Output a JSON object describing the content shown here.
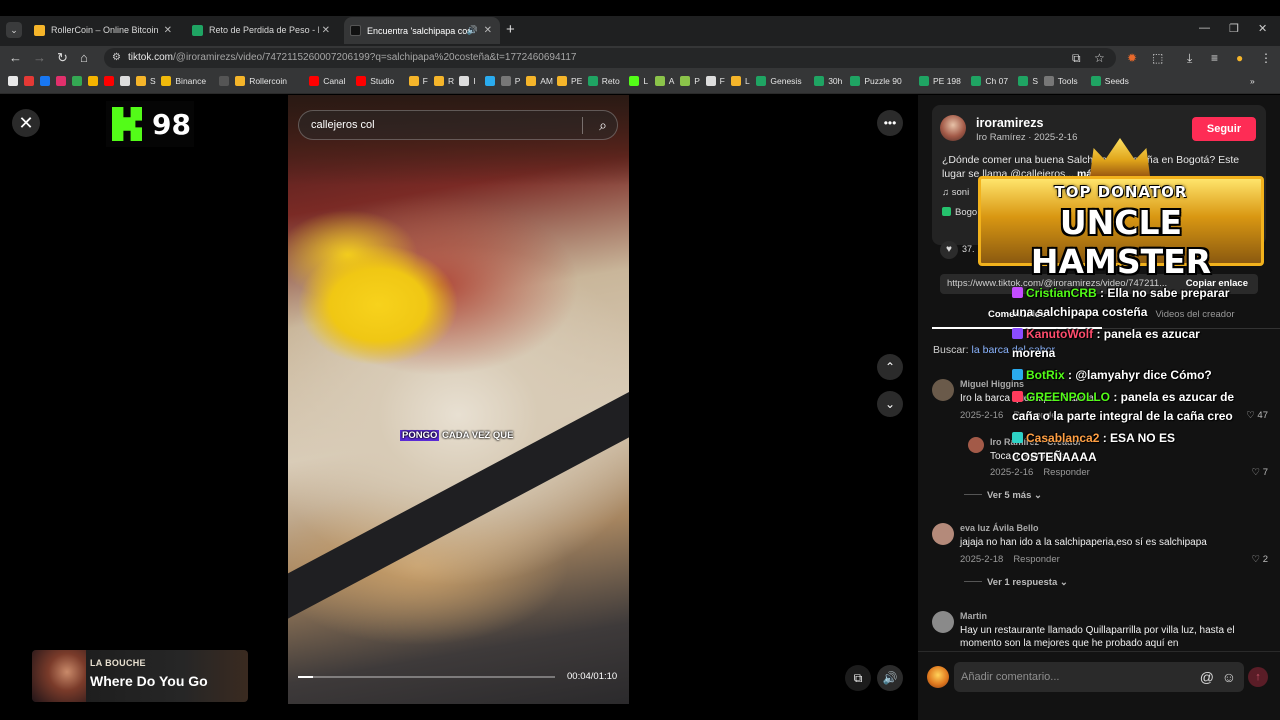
{
  "browser": {
    "tabs": [
      {
        "title": "RollerCoin – Online Bitcoin Mini",
        "favicon_color": "#f5b52a"
      },
      {
        "title": "Reto de Perdida de Peso - El M",
        "favicon_color": "#1fa463"
      },
      {
        "title": "Encuentra 'salchipapa coste",
        "favicon_color": "#111111"
      }
    ],
    "url_host": "tiktok.com",
    "url_rest": "/@iroramirezs/video/7472115260007206199?q=salchipapa%20costeña&t=1772460694117"
  },
  "bookmarks": [
    {
      "label": "",
      "color": "#e8e8e8"
    },
    {
      "label": "",
      "color": "#e53935"
    },
    {
      "label": "",
      "color": "#1877f2"
    },
    {
      "label": "",
      "color": "#e1306c"
    },
    {
      "label": "",
      "color": "#34a853"
    },
    {
      "label": "",
      "color": "#f4b400"
    },
    {
      "label": "",
      "color": "#ff0000"
    },
    {
      "label": "",
      "color": "#dddddd"
    },
    {
      "label": "S",
      "color": "#f5b52a"
    },
    {
      "label": "Binance",
      "color": "#f0b90b"
    },
    {
      "label": "",
      "color": "#555555"
    },
    {
      "label": "Rollercoin",
      "color": "#f5b52a"
    },
    {
      "label": "Canal",
      "color": "#ff0000"
    },
    {
      "label": "Studio",
      "color": "#ff0000"
    },
    {
      "label": "F",
      "color": "#f5b52a"
    },
    {
      "label": "R",
      "color": "#f5b52a"
    },
    {
      "label": "I",
      "color": "#dddddd"
    },
    {
      "label": "",
      "color": "#2aabee"
    },
    {
      "label": "P",
      "color": "#777777"
    },
    {
      "label": "AM",
      "color": "#f5b52a"
    },
    {
      "label": "PE",
      "color": "#f5b52a"
    },
    {
      "label": "Reto",
      "color": "#1fa463"
    },
    {
      "label": "L",
      "color": "#53fc18"
    },
    {
      "label": "A",
      "color": "#8bc34a"
    },
    {
      "label": "P",
      "color": "#8bc34a"
    },
    {
      "label": "F",
      "color": "#dddddd"
    },
    {
      "label": "L",
      "color": "#f5b52a"
    },
    {
      "label": "Genesis",
      "color": "#1fa463"
    },
    {
      "label": "30h",
      "color": "#1fa463"
    },
    {
      "label": "Puzzle 90",
      "color": "#1fa463"
    },
    {
      "label": "PE 198",
      "color": "#1fa463"
    },
    {
      "label": "Ch 07",
      "color": "#1fa463"
    },
    {
      "label": "S",
      "color": "#1fa463"
    },
    {
      "label": "Tools",
      "color": "#777777"
    },
    {
      "label": "Seeds",
      "color": "#1fa463"
    }
  ],
  "overlay": {
    "kick_count": "98",
    "now_playing_artist": "LA BOUCHE",
    "now_playing_song": "Where Do You Go",
    "donator_title": "TOP DONATOR",
    "donator_name": "UNCLE HAMSTER",
    "chat": [
      {
        "user": "CristianCRB",
        "color": "#53fc18",
        "message": ": Ella no sabe preparar una salchipapa costeña"
      },
      {
        "user": "KanutoWolf",
        "color": "#ff4d6d",
        "message": ": panela es azucar morena"
      },
      {
        "user": "BotRix",
        "color": "#53fc18",
        "message": ": @lamyahyr dice Cómo?"
      },
      {
        "user": "GREENPOLLO",
        "color": "#53fc18",
        "message": ": panela es azucar de caña o la parte integral de la caña creo"
      },
      {
        "user": "Casablanca2",
        "color": "#ff9f43",
        "message": ": ESA NO ES COSTEÑAAAA"
      }
    ]
  },
  "video": {
    "search_query": "callejeros col",
    "caption_highlight": "PONGO",
    "caption_rest": " CADA VEZ QUE",
    "time": "00:04/01:10",
    "progress": 0.057
  },
  "post": {
    "author": "iroramirezs",
    "meta": "Iro Ramírez · 2025-2-16",
    "follow_label": "Seguir",
    "description": "¿Dónde comer una buena Salchipapa costeña en Bogotá? Este lugar se llama @callejeros...",
    "more_label": "más",
    "music": "soni",
    "location": "Bogo",
    "likes": "37.",
    "link": "https://www.tiktok.com/@iroramirezs/video/747211...",
    "copy_label": "Copiar enlace"
  },
  "tabs": {
    "comments": "Comentarios",
    "creator": "Videos del creador"
  },
  "search_hint": {
    "label": "Buscar:",
    "query": "la barca del sabor"
  },
  "comments": [
    {
      "name": "Miguel Higgins",
      "text": "Iro la barca queda por Francia",
      "date": "2025-2-16",
      "reply": "Responder",
      "likes": "47",
      "avatar_color": "#6a5a4a"
    },
    {
      "name": "Iro Ramírez · Creador",
      "text": "Toca ir a probarla",
      "date": "2025-2-16",
      "reply": "Responder",
      "likes": "7",
      "avatar_color": "#a35a48"
    },
    {
      "name": "eva luz Ávila Bello",
      "text": "jajaja no han ido a la salchipaperia,eso sí es salchipapa",
      "date": "2025-2-18",
      "reply": "Responder",
      "likes": "2",
      "avatar_color": "#b48a7a"
    },
    {
      "name": "Martin",
      "text": "Hay un restaurante llamado Quillaparrilla por villa luz, hasta el momento son la mejores que he probado aquí en",
      "date": "",
      "reply": "",
      "likes": "",
      "avatar_color": "#8a8a8a"
    }
  ],
  "view_more": [
    "Ver 5 más",
    "Ver 1 respuesta"
  ],
  "comment_input_placeholder": "Añadir comentario..."
}
